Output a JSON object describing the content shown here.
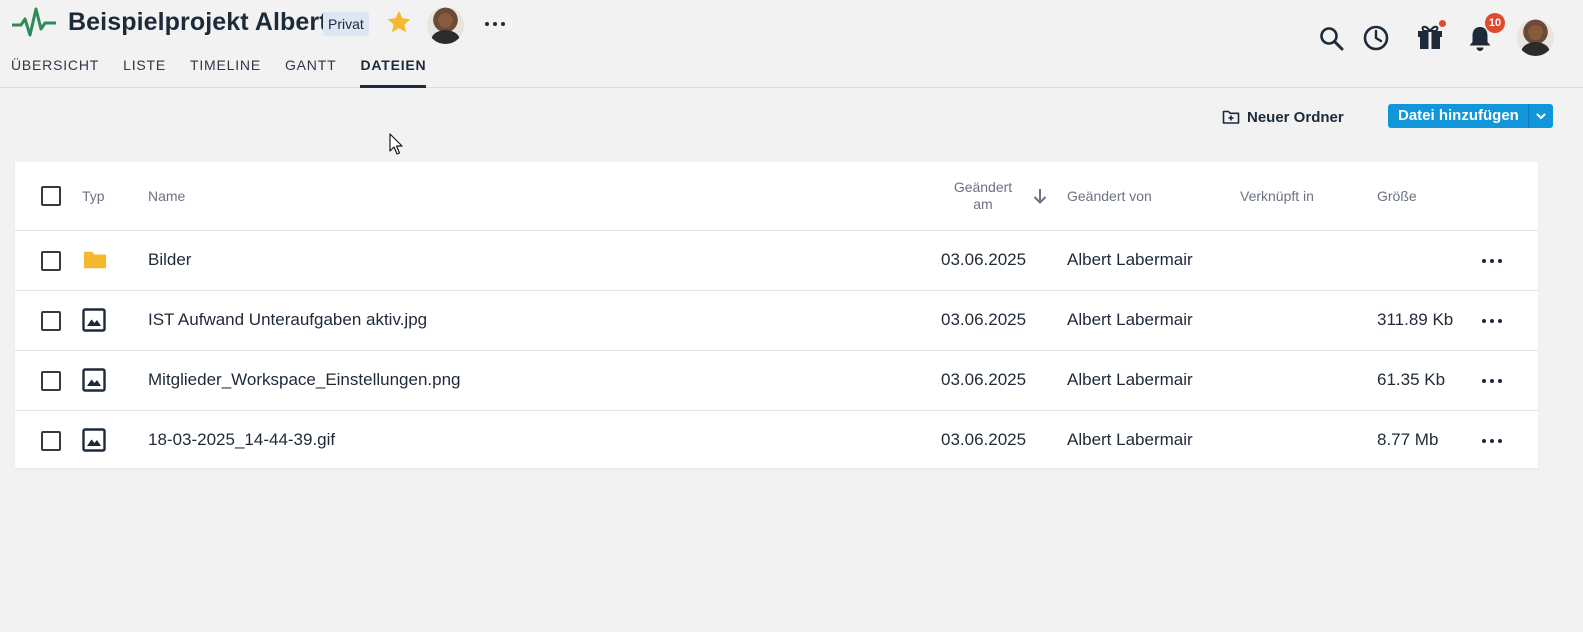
{
  "header": {
    "project_title": "Beispielprojekt Albert",
    "badge": "Privat",
    "tabs": [
      "ÜBERSICHT",
      "LISTE",
      "TIMELINE",
      "GANTT",
      "DATEIEN"
    ],
    "active_tab": "DATEIEN",
    "notification_count": "10"
  },
  "toolbar": {
    "new_folder_label": "Neuer Ordner",
    "add_file_label": "Datei hinzufügen"
  },
  "table": {
    "columns": {
      "type": "Typ",
      "name": "Name",
      "changed_at": "Geändert am",
      "changed_by": "Geändert von",
      "linked_in": "Verknüpft in",
      "size": "Größe"
    },
    "rows": [
      {
        "type": "folder",
        "name": "Bilder",
        "changed_at": "03.06.2025",
        "changed_by": "Albert Labermair",
        "linked_in": "",
        "size": ""
      },
      {
        "type": "image",
        "name": "IST Aufwand Unteraufgaben aktiv.jpg",
        "changed_at": "03.06.2025",
        "changed_by": "Albert Labermair",
        "linked_in": "",
        "size": "311.89 Kb"
      },
      {
        "type": "image",
        "name": "Mitglieder_Workspace_Einstellungen.png",
        "changed_at": "03.06.2025",
        "changed_by": "Albert Labermair",
        "linked_in": "",
        "size": "61.35 Kb"
      },
      {
        "type": "image",
        "name": "18-03-2025_14-44-39.gif",
        "changed_at": "03.06.2025",
        "changed_by": "Albert Labermair",
        "linked_in": "",
        "size": "8.77 Mb"
      }
    ]
  },
  "colors": {
    "accent": "#1296db",
    "title": "#1d2a3a",
    "folder": "#f6b82e",
    "star": "#f6b82e",
    "badge_bg": "#dde6f3",
    "notification": "#e04a2f"
  },
  "icons": [
    "pulse-logo-icon",
    "star-icon",
    "more-horizontal-icon",
    "search-icon",
    "clock-icon",
    "gift-icon",
    "bell-icon",
    "folder-plus-icon",
    "chevron-down-icon",
    "arrow-down-icon",
    "folder-icon",
    "image-icon"
  ]
}
